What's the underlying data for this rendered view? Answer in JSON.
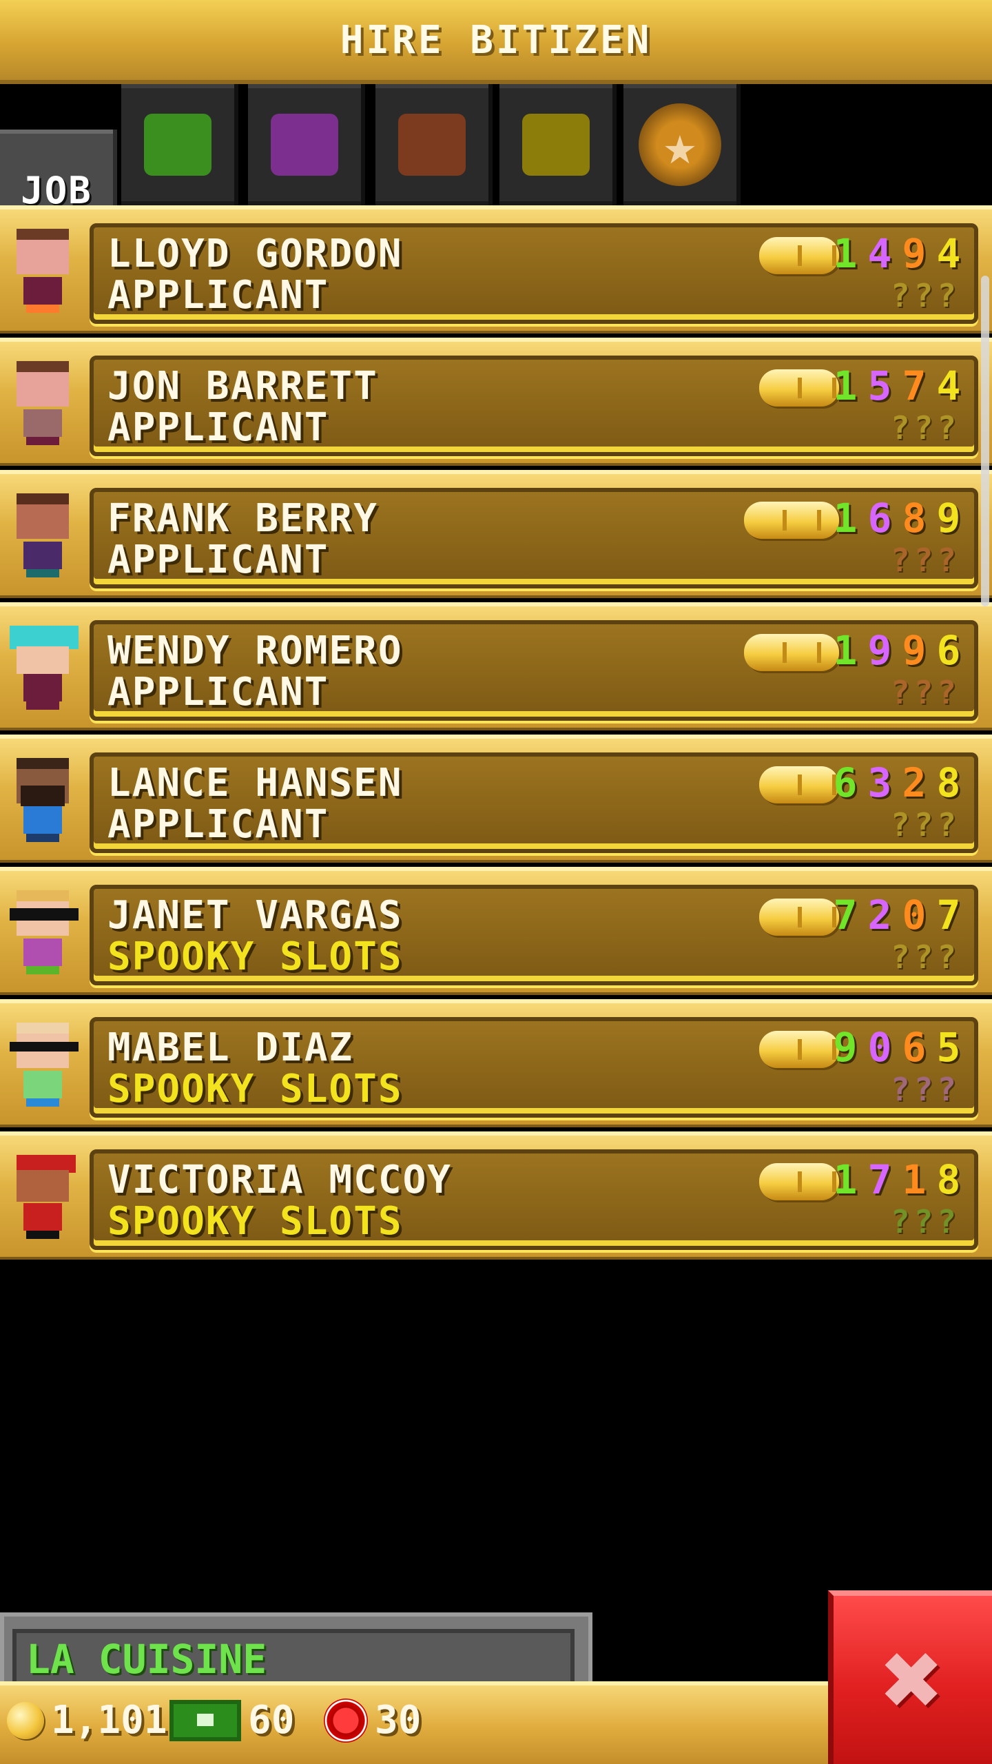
{
  "header": {
    "title": "HIRE BITIZEN"
  },
  "tabs": {
    "job_label": "JOB",
    "chips": [
      {
        "name": "green-chip",
        "color": "#3a8f1f"
      },
      {
        "name": "purple-chip",
        "color": "#7c2f8e"
      },
      {
        "name": "orange-chip",
        "color": "#7c3a1e"
      },
      {
        "name": "yellow-chip",
        "color": "#8c7d0a"
      },
      {
        "name": "star-chip",
        "color": "#8b5a13"
      }
    ]
  },
  "applicants": [
    {
      "name": "LLOYD GORDON",
      "job": "APPLICANT",
      "digits": [
        "1",
        "4",
        "9",
        "4"
      ],
      "digit_colors": [
        "#71e52a",
        "#d766ff",
        "#ff8a1e",
        "#f3e21e"
      ],
      "q": "???",
      "q_color": "#b59c2a"
    },
    {
      "name": "JON BARRETT",
      "job": "APPLICANT",
      "digits": [
        "1",
        "5",
        "7",
        "4"
      ],
      "digit_colors": [
        "#71e52a",
        "#d766ff",
        "#ff8a1e",
        "#f3e21e"
      ],
      "q": "???",
      "q_color": "#b59c2a"
    },
    {
      "name": "FRANK BERRY",
      "job": "APPLICANT",
      "digits": [
        "1",
        "6",
        "8",
        "9"
      ],
      "digit_colors": [
        "#71e52a",
        "#d766ff",
        "#ff8a1e",
        "#f3e21e"
      ],
      "q": "???",
      "q_color": "#b0662e"
    },
    {
      "name": "WENDY ROMERO",
      "job": "APPLICANT",
      "digits": [
        "1",
        "9",
        "9",
        "6"
      ],
      "digit_colors": [
        "#71e52a",
        "#d766ff",
        "#ff8a1e",
        "#f3e21e"
      ],
      "q": "???",
      "q_color": "#b0662e"
    },
    {
      "name": "LANCE HANSEN",
      "job": "APPLICANT",
      "digits": [
        "6",
        "3",
        "2",
        "8"
      ],
      "digit_colors": [
        "#71e52a",
        "#d766ff",
        "#ff8a1e",
        "#f3e21e"
      ],
      "q": "???",
      "q_color": "#b59c2a"
    },
    {
      "name": "JANET VARGAS",
      "job": "SPOOKY SLOTS",
      "digits": [
        "7",
        "2",
        "0",
        "7"
      ],
      "digit_colors": [
        "#71e52a",
        "#d766ff",
        "#ff8a1e",
        "#f3e21e"
      ],
      "q": "???",
      "q_color": "#b59c2a"
    },
    {
      "name": "MABEL DIAZ",
      "job": "SPOOKY SLOTS",
      "digits": [
        "9",
        "0",
        "6",
        "5"
      ],
      "digit_colors": [
        "#71e52a",
        "#d766ff",
        "#ff8a1e",
        "#f3e21e"
      ],
      "q": "???",
      "q_color": "#a56a8a"
    },
    {
      "name": "VICTORIA MCCOY",
      "job": "SPOOKY SLOTS",
      "digits": [
        "1",
        "7",
        "1",
        "8"
      ],
      "digit_colors": [
        "#71e52a",
        "#d766ff",
        "#ff8a1e",
        "#f3e21e"
      ],
      "q": "???",
      "q_color": "#6f9a2a"
    }
  ],
  "location": {
    "label": "LA CUISINE"
  },
  "resources": {
    "coins": "1,101",
    "bux": "60",
    "chips": "30"
  },
  "close": {
    "icon": "close-icon"
  }
}
